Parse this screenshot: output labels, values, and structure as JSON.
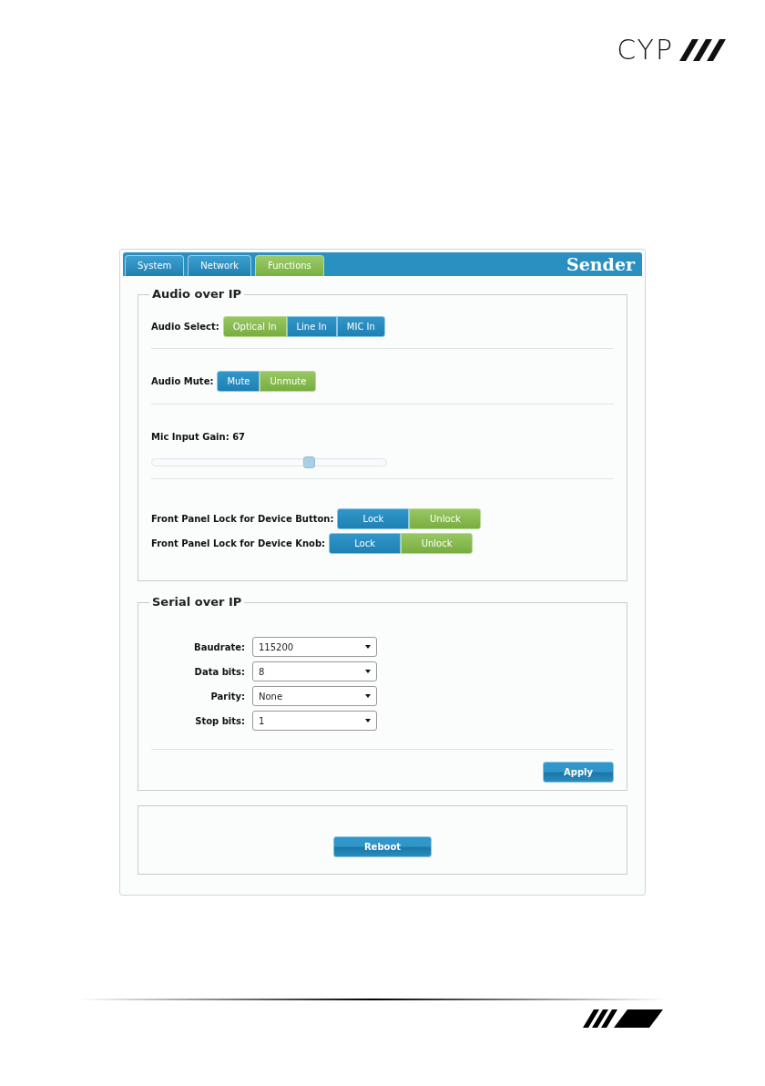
{
  "logo": {
    "text": "CYP"
  },
  "tabs": [
    {
      "label": "System",
      "selected": false
    },
    {
      "label": "Network",
      "selected": false
    },
    {
      "label": "Functions",
      "selected": true
    }
  ],
  "device_title": "Sender",
  "audio_section": {
    "legend": "Audio over IP",
    "groups": [
      {
        "kind": "buttons",
        "label": "Audio Select:",
        "options": [
          {
            "label": "Optical In",
            "selected": true
          },
          {
            "label": "Line In",
            "selected": false
          },
          {
            "label": "MIC In",
            "selected": false
          }
        ]
      },
      {
        "kind": "buttons",
        "label": "Audio Mute:",
        "options": [
          {
            "label": "Mute",
            "selected": false
          },
          {
            "label": "Unmute",
            "selected": true
          }
        ]
      },
      {
        "kind": "slider",
        "label": "Mic Input Gain: 67",
        "level": 0.67
      },
      {
        "kind": "locks",
        "rows": [
          {
            "label": "Front Panel Lock for Device Button:",
            "options": [
              {
                "label": "Lock",
                "selected": false
              },
              {
                "label": "Unlock",
                "selected": true
              }
            ]
          },
          {
            "label": "Front Panel Lock for Device Knob:",
            "options": [
              {
                "label": "Lock",
                "selected": false
              },
              {
                "label": "Unlock",
                "selected": true
              }
            ]
          }
        ]
      }
    ]
  },
  "serial_section": {
    "legend": "Serial over IP",
    "fields": [
      {
        "label": "Baudrate:",
        "value": "115200"
      },
      {
        "label": "Data bits:",
        "value": "8"
      },
      {
        "label": "Parity:",
        "value": "None"
      },
      {
        "label": "Stop bits:",
        "value": "1"
      }
    ],
    "apply_button": "Apply"
  },
  "reboot_button": "Reboot"
}
